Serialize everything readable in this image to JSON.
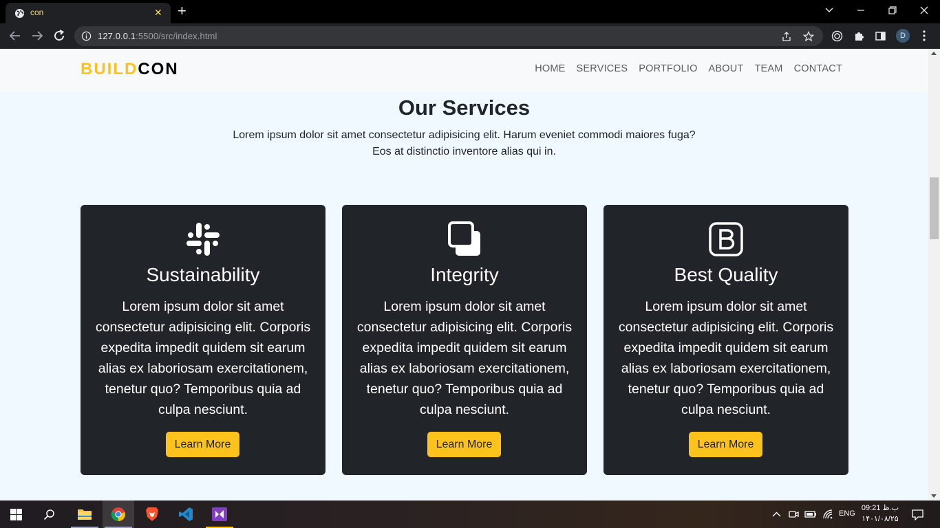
{
  "browser": {
    "tab_title": "con",
    "tab_close": "✕",
    "new_tab": "+",
    "url_host": "127.0.0.1",
    "url_rest": ":5500/src/index.html",
    "profile_initial": "D"
  },
  "site": {
    "brand_part1": "BUILD",
    "brand_part2": "CON",
    "nav": [
      "HOME",
      "SERVICES",
      "PORTFOLIO",
      "ABOUT",
      "TEAM",
      "CONTACT"
    ]
  },
  "services": {
    "title": "Our Services",
    "subtitle_line1": "Lorem ipsum dolor sit amet consectetur adipisicing elit. Harum eveniet commodi maiores fuga?",
    "subtitle_line2": "Eos at distinctio inventore alias qui in.",
    "cards": [
      {
        "icon": "slack-icon",
        "title": "Sustainability",
        "text": "Lorem ipsum dolor sit amet consectetur adipisicing elit. Corporis expedita impedit quidem sit earum alias ex laboriosam exercitationem, tenetur quo? Temporibus quia ad culpa nesciunt.",
        "button": "Learn More"
      },
      {
        "icon": "copy-icon",
        "title": "Integrity",
        "text": "Lorem ipsum dolor sit amet consectetur adipisicing elit. Corporis expedita impedit quidem sit earum alias ex laboriosam exercitationem, tenetur quo? Temporibus quia ad culpa nesciunt.",
        "button": "Learn More"
      },
      {
        "icon": "bootstrap-icon",
        "title": "Best Quality",
        "text": "Lorem ipsum dolor sit amet consectetur adipisicing elit. Corporis expedita impedit quidem sit earum alias ex laboriosam exercitationem, tenetur quo? Temporibus quia ad culpa nesciunt.",
        "button": "Learn More"
      }
    ]
  },
  "taskbar": {
    "language": "ENG",
    "time": "09:21 ب.ظ",
    "date": "۱۴۰۱/۰۸/۲۵"
  },
  "colors": {
    "accent": "#fdc31c",
    "card_bg": "#212529",
    "page_bg": "#f0f9ff"
  }
}
